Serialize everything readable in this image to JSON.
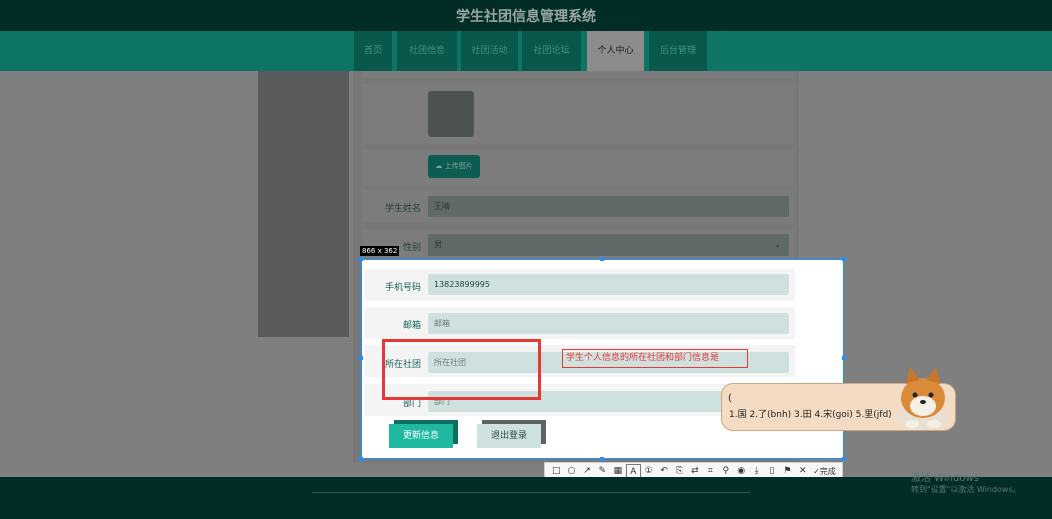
{
  "site": {
    "title": "学生社团信息管理系统"
  },
  "nav": {
    "tabs": [
      "首页",
      "社团信息",
      "社团活动",
      "社团论坛",
      "个人中心",
      "后台管理"
    ],
    "active_index": 4
  },
  "profile": {
    "upload_label": "上传图片",
    "name_label": "学生姓名",
    "name_value": "王晴",
    "gender_label": "性别",
    "gender_value": "男",
    "phone_label": "手机号码",
    "phone_value": "13823899995",
    "email_label": "邮箱",
    "email_placeholder": "邮箱",
    "club_label": "所在社团",
    "club_placeholder": "所在社团",
    "dept_label": "部门",
    "dept_placeholder": "部门",
    "update_button": "更新信息",
    "logout_button": "退出登录"
  },
  "capture": {
    "size_label": "866 x 362",
    "annotation_text": "学生个人信息的所在社团和部门信息是"
  },
  "snip_toolbar": {
    "icons": [
      "rect-icon",
      "ellipse-icon",
      "arrow-icon",
      "pen-icon",
      "mosaic-icon",
      "text-icon",
      "number-icon",
      "undo-icon",
      "ocr-icon",
      "translate-icon",
      "scan-icon",
      "pin-icon",
      "record-icon",
      "download-icon",
      "copy-icon",
      "bookmark-icon",
      "close-icon",
      "check-icon"
    ],
    "finish_label": "完成"
  },
  "text_toolbar": {
    "font_size": "12",
    "current_color": "#ee2b2b",
    "swatches": [
      "#000000",
      "#808080",
      "#8b0000",
      "#8b4513",
      "#808000",
      "#006400",
      "#00008b",
      "#800080",
      "#008b8b",
      "#ffffff",
      "#c0c0c0",
      "#ff0000",
      "#ffa500",
      "#ffff00",
      "#00ff00",
      "#0000ff",
      "#ff00ff",
      "#00ffff"
    ]
  },
  "ime": {
    "cursor": "(",
    "candidates": "1.国  2.了(bnh)  3.田  4.宋(goi)  5.里(jfd)"
  },
  "windows": {
    "activate_title": "激活 Windows",
    "activate_sub": "转到\"设置\"以激活 Windows。"
  }
}
